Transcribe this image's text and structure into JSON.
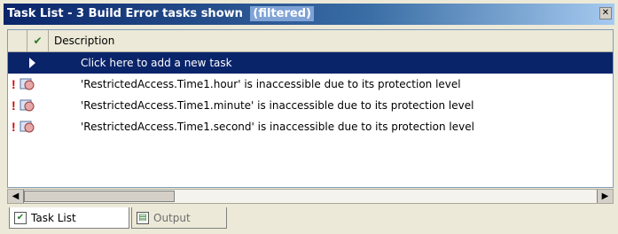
{
  "window": {
    "title": "Task List - 3 Build Error tasks shown",
    "filtered_label": "(filtered)"
  },
  "columns": {
    "check": "✔",
    "description": "Description"
  },
  "new_task_row": "Click here to add a new task",
  "tasks": [
    {
      "description": "'RestrictedAccess.Time1.hour' is inaccessible due to its protection level"
    },
    {
      "description": "'RestrictedAccess.Time1.minute' is inaccessible due to its protection level"
    },
    {
      "description": "'RestrictedAccess.Time1.second' is inaccessible due to its protection level"
    }
  ],
  "tabs": [
    {
      "label": "Task List"
    },
    {
      "label": "Output"
    }
  ],
  "colors": {
    "selection": "#0a246a",
    "error": "#d40000"
  }
}
